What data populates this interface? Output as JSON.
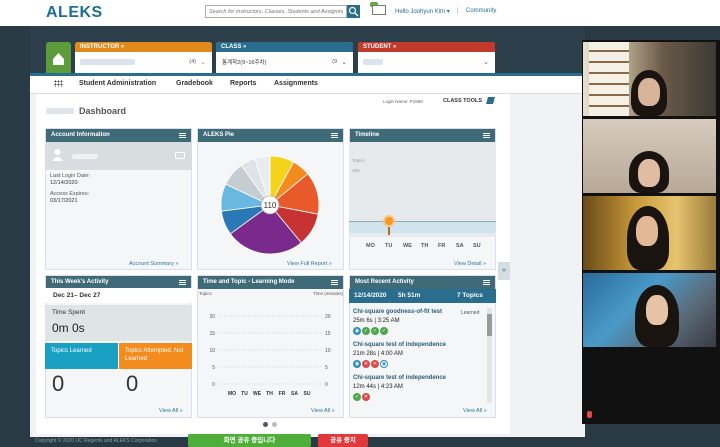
{
  "header": {
    "logo": "ALEKS",
    "search_placeholder": "Search for Instructors, Classes, Students and Assignments",
    "greeting": "Hello Joohyun Kim ▾",
    "community": "Community",
    "separator": "|"
  },
  "selectors": {
    "instructor": {
      "label": "INSTRUCTOR »",
      "count": "(4)"
    },
    "class": {
      "label": "CLASS »",
      "value": "통계학2(9~16주차)",
      "count": "(9"
    },
    "student": {
      "label": "STUDENT »"
    }
  },
  "nav": [
    "Student Administration",
    "Gradebook",
    "Reports",
    "Assignments"
  ],
  "dashboard": {
    "title": "Dashboard",
    "login_name": "Login Name: P1868",
    "class_tools": "CLASS TOOLS"
  },
  "account": {
    "title": "Account Information",
    "last_login_label": "Last Login Date:",
    "last_login": "12/14/2020",
    "expires_label": "Access Expires:",
    "expires": "03/17/2021",
    "link": "Account Summary »"
  },
  "pie": {
    "title": "ALEKS Pie",
    "center": "110",
    "link": "View Full Report »"
  },
  "chart_data": {
    "type": "pie",
    "title": "ALEKS Pie",
    "slices": [
      {
        "color": "#f4d41a",
        "value": 8
      },
      {
        "color": "#f28c1e",
        "value": 6
      },
      {
        "color": "#e85a2a",
        "value": 14
      },
      {
        "color": "#c73232",
        "value": 11
      },
      {
        "color": "#7a2a8c",
        "value": 26
      },
      {
        "color": "#2a78b5",
        "value": 8
      },
      {
        "color": "#6ab8e0",
        "value": 9
      },
      {
        "color": "#c5ccd2",
        "value": 8
      },
      {
        "color": "#dfe3e6",
        "value": 5
      },
      {
        "color": "#e9ecee",
        "value": 5
      }
    ]
  },
  "timeline": {
    "title": "Timeline",
    "y_label": "Topics",
    "y_top": "100",
    "days": [
      "MO",
      "TU",
      "WE",
      "TH",
      "FR",
      "SA",
      "SU"
    ],
    "link": "View Detail »"
  },
  "week": {
    "title": "This Week's Activity",
    "range": "Dec 21– Dec 27",
    "time_label": "Time Spent",
    "time_value": "0m 0s",
    "learned_label": "Topics Learned",
    "attempted_label": "Topics Attempted, Not Learned",
    "learned_value": "0",
    "attempted_value": "0",
    "link": "View All »"
  },
  "time_topic": {
    "title": "Time and Topic - Learning Mode",
    "left_axis": "Topics",
    "right_axis": "Time (minutes)",
    "ticks": [
      "20",
      "15",
      "10",
      "5",
      "0"
    ],
    "days": [
      "MO",
      "TU",
      "WE",
      "TH",
      "FR",
      "SA",
      "SU"
    ],
    "link": "View All »"
  },
  "recent": {
    "title": "Most Recent Activity",
    "date": "12/14/2020",
    "duration": "5h 51m",
    "topics": "7 Topics",
    "learned_label": "Learned",
    "items": [
      {
        "name": "Chi-square goodness-of-fit test",
        "time": "25m 6s",
        "clock": "3:25 AM",
        "icons": [
          "b",
          "g",
          "g",
          "g"
        ],
        "learned": true
      },
      {
        "name": "Chi-square test of independence",
        "time": "21m 28s",
        "clock": "4:00 AM",
        "icons": [
          "b",
          "r",
          "r",
          "w"
        ],
        "learned": false
      },
      {
        "name": "Chi-square test of independence",
        "time": "12m 44s",
        "clock": "4:23 AM",
        "icons": [
          "g",
          "r"
        ],
        "learned": false
      }
    ],
    "link": "View All »"
  },
  "footer": {
    "copyright": "Copyright © 2020 UC Regents and ALEKS Corporation",
    "share": "화면 공유 중입니다",
    "stop": "공유 중지"
  }
}
